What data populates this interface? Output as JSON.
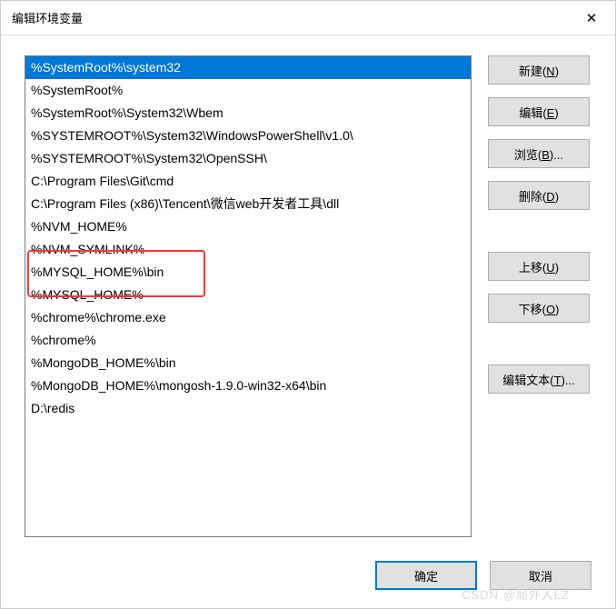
{
  "window": {
    "title": "编辑环境变量",
    "close": "✕"
  },
  "list": {
    "items": [
      "%SystemRoot%\\system32",
      "%SystemRoot%",
      "%SystemRoot%\\System32\\Wbem",
      "%SYSTEMROOT%\\System32\\WindowsPowerShell\\v1.0\\",
      "%SYSTEMROOT%\\System32\\OpenSSH\\",
      "C:\\Program Files\\Git\\cmd",
      "C:\\Program Files (x86)\\Tencent\\微信web开发者工具\\dll",
      "%NVM_HOME%",
      "%NVM_SYMLINK%",
      "%MYSQL_HOME%\\bin",
      "%MYSQL_HOME%",
      "%chrome%\\chrome.exe",
      "%chrome%",
      "%MongoDB_HOME%\\bin",
      "%MongoDB_HOME%\\mongosh-1.9.0-win32-x64\\bin",
      "D:\\redis"
    ],
    "selectedIndex": 0
  },
  "buttons": {
    "new": {
      "text": "新建(",
      "key": "N",
      "suffix": ")"
    },
    "edit": {
      "text": "编辑(",
      "key": "E",
      "suffix": ")"
    },
    "browse": {
      "text": "浏览(",
      "key": "B",
      "suffix": ")..."
    },
    "delete": {
      "text": "删除(",
      "key": "D",
      "suffix": ")"
    },
    "moveUp": {
      "text": "上移(",
      "key": "U",
      "suffix": ")"
    },
    "moveDown": {
      "text": "下移(",
      "key": "O",
      "suffix": ")"
    },
    "editText": {
      "text": "编辑文本(",
      "key": "T",
      "suffix": ")..."
    },
    "ok": "确定",
    "cancel": "取消"
  },
  "watermark": "CSDN @局外人LZ"
}
